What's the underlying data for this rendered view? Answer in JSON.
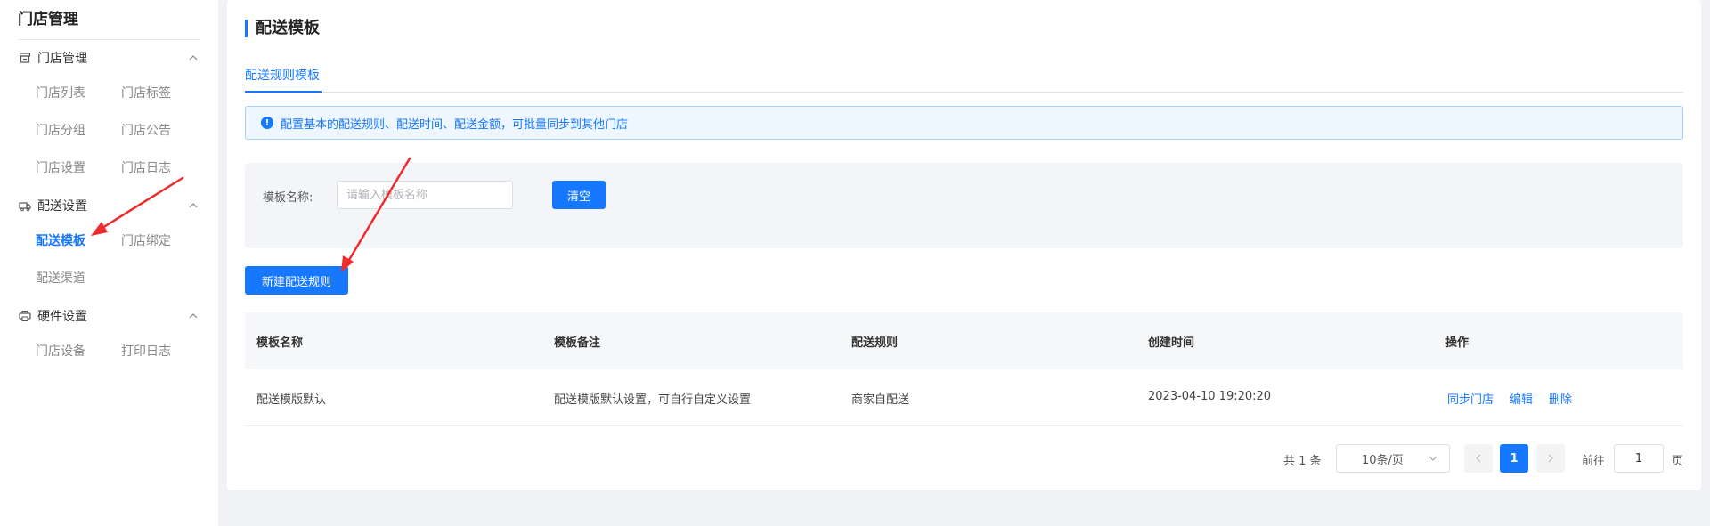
{
  "sidebar": {
    "title": "门店管理",
    "groups": [
      {
        "label": "门店管理",
        "icon": "store-icon",
        "items": [
          "门店列表",
          "门店标签",
          "门店分组",
          "门店公告",
          "门店设置",
          "门店日志"
        ]
      },
      {
        "label": "配送设置",
        "icon": "delivery-icon",
        "items": [
          "配送模板",
          "门店绑定",
          "配送渠道"
        ]
      },
      {
        "label": "硬件设置",
        "icon": "printer-icon",
        "items": [
          "门店设备",
          "打印日志"
        ]
      }
    ],
    "active_item": "配送模板"
  },
  "page": {
    "title": "配送模板",
    "tab": "配送规则模板",
    "alert": "配置基本的配送规则、配送时间、配送金额，可批量同步到其他门店"
  },
  "filter": {
    "label": "模板名称:",
    "placeholder": "请输入模板名称",
    "clear_label": "清空"
  },
  "new_button_label": "新建配送规则",
  "table": {
    "columns": [
      "模板名称",
      "模板备注",
      "配送规则",
      "创建时间",
      "操作"
    ],
    "rows": [
      {
        "name": "配送模版默认",
        "remark": "配送模版默认设置，可自行自定义设置",
        "rule": "商家自配送",
        "created": "2023-04-10 19:20:20",
        "actions": [
          "同步门店",
          "编辑",
          "删除"
        ]
      }
    ]
  },
  "pagination": {
    "total": "共 1 条",
    "page_size": "10条/页",
    "current": "1",
    "goto_label": "前往",
    "goto_value": "1",
    "page_suffix": "页"
  },
  "colors": {
    "accent": "#1677ff",
    "annotation_arrow": "#f02b2b"
  }
}
